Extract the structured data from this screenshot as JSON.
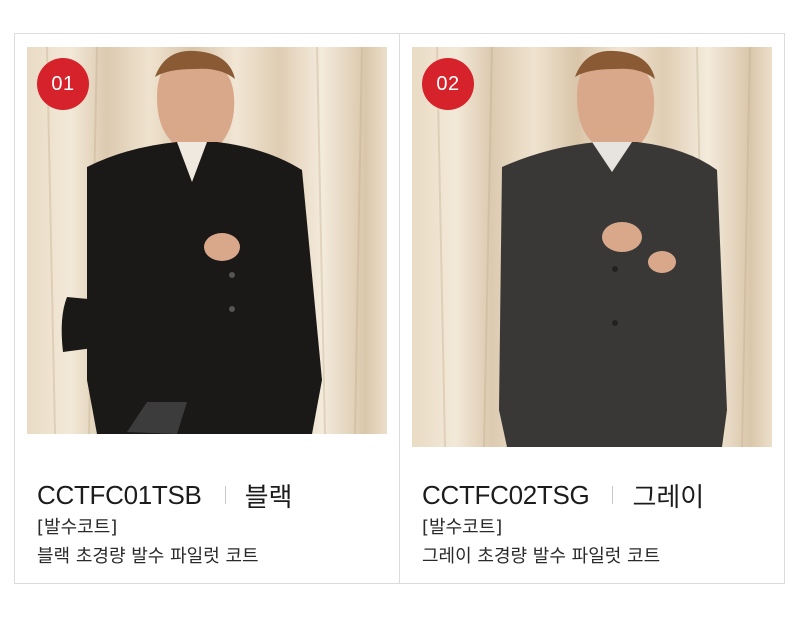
{
  "products": [
    {
      "badge": "01",
      "image_alt": "Model wearing black water-repellent padded coat",
      "code": "CCTFC01TSB",
      "color_name": "블랙",
      "category": "[발수코트]",
      "description": "블랙 초경량 발수 파일럿 코트",
      "coat_color": "#1b1917"
    },
    {
      "badge": "02",
      "image_alt": "Model wearing grey water-repellent padded coat",
      "code": "CCTFC02TSG",
      "color_name": "그레이",
      "category": "[발수코트]",
      "description": "그레이 초경량 발수 파일럿 코트",
      "coat_color": "#3a3836"
    }
  ],
  "colors": {
    "badge": "#d6222b",
    "border": "#dcdcdc"
  }
}
